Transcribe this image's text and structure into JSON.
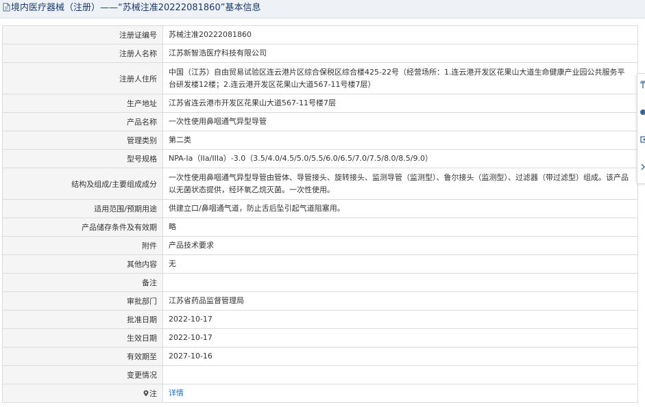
{
  "header": {
    "title": "境内医疗器械（注册）——“苏械注准20222081860”基本信息",
    "icon": "document-icon"
  },
  "rows": [
    {
      "label": "注册证编号",
      "value": "苏械注准20222081860"
    },
    {
      "label": "注册人名称",
      "value": "江苏新智浩医疗科技有限公司"
    },
    {
      "label": "注册人住所",
      "value": "中国（江苏）自由贸易试验区连云港片区综合保税区综合楼425-22号（经营场所：1.连云港开发区花果山大道生命健康产业园公共服务平台研发楼12楼；2.连云港开发区花果山大道567-11号楼7层）"
    },
    {
      "label": "生产地址",
      "value": "江苏省连云港市开发区花果山大道567-11号楼7层"
    },
    {
      "label": "产品名称",
      "value": "一次性使用鼻咽通气异型导管"
    },
    {
      "label": "管理类别",
      "value": "第二类"
    },
    {
      "label": "型号规格",
      "value": "NPA-Ia（IIa/IIIa）-3.0（3.5/4.0/4.5/5.0/5.5/6.0/6.5/7.0/7.5/8.0/8.5/9.0）"
    },
    {
      "label": "结构及组成/主要组成成分",
      "value": "一次性使用鼻咽通气异型导管由管体、导管接头、旋转接头、监测导管（监测型）、鲁尔接头（监测型）、过滤器（带过滤型）组成。该产品以无菌状态提供，经环氧乙烷灭菌。一次性使用。"
    },
    {
      "label": "适用范围/预期用途",
      "value": "供建立口/鼻咽通气道，防止舌后坠引起气道阻塞用。"
    },
    {
      "label": "产品储存条件及有效期",
      "value": "略"
    },
    {
      "label": "附件",
      "value": "产品技术要求"
    },
    {
      "label": "其他内容",
      "value": "无"
    },
    {
      "label": "备注",
      "value": ""
    },
    {
      "label": "审批部门",
      "value": "江苏省药品监督管理局"
    },
    {
      "label": "批准日期",
      "value": "2022-10-17"
    },
    {
      "label": "生效日期",
      "value": "2022-10-17"
    },
    {
      "label": "有效期至",
      "value": "2027-10-16"
    },
    {
      "label": "变更情况",
      "value": ""
    }
  ],
  "note": {
    "label": "注",
    "link": "详情",
    "icon": "pin-icon"
  },
  "side_toolbar": {
    "icons": [
      "side-icon-1",
      "side-icon-2",
      "side-icon-3",
      "chevron-right-icon"
    ]
  },
  "colors": {
    "label_bg": "#f5f5f5",
    "link": "#1a6fc4",
    "header_bg": "#eef1f5",
    "header_text": "#1a3b6b"
  }
}
